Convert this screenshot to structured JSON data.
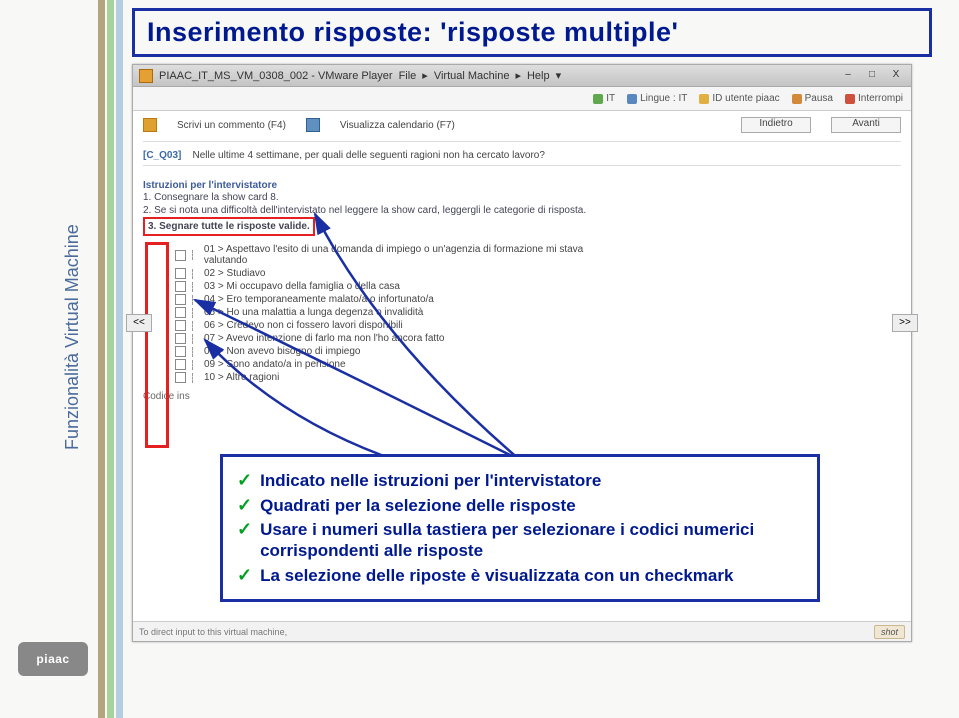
{
  "sidebar": {
    "label": "Funzionalità Virtual Machine"
  },
  "logo": {
    "text": "piaac"
  },
  "title": "Inserimento risposte: 'risposte multiple'",
  "vm": {
    "title": "PIAAC_IT_MS_VM_0308_002 - VMware Player",
    "menu": {
      "file": "File",
      "vm_menu": "Virtual Machine",
      "help": "Help"
    },
    "winbtns": {
      "min": "–",
      "max": "□",
      "close": "X"
    },
    "toolbar": {
      "it": "IT",
      "lingue": "Lingue : IT",
      "id": "ID utente piaac",
      "pausa": "Pausa",
      "interrompi": "Interrompi"
    },
    "row1": {
      "scrivi": "Scrivi un commento (F4)",
      "visualizza": "Visualizza calendario (F7)",
      "indietro": "Indietro",
      "avanti": "Avanti"
    },
    "nav": {
      "prev": "<<",
      "next": ">>"
    },
    "question": {
      "code": "[C_Q03]",
      "text": "Nelle ultime 4 settimane, per quali delle seguenti ragioni non ha cercato lavoro?"
    },
    "instructions": {
      "head": "Istruzioni per l'intervistatore",
      "l1": "1. Consegnare la show card 8.",
      "l2": "2. Se si nota una difficoltà dell'intervistato nel leggere la show card, leggergli le categorie di risposta.",
      "l3": "3. Segnare tutte le risposte valide."
    },
    "options": [
      "01 > Aspettavo l'esito di una domanda di impiego o un'agenzia di formazione mi stava valutando",
      "02 > Studiavo",
      "03 > Mi occupavo della famiglia o della casa",
      "04 > Ero temporaneamente malato/a o infortunato/a",
      "05 > Ho una malattia a lunga degenza o invalidità",
      "06 > Credevo non ci fossero lavori disponibili",
      "07 > Avevo intenzione di farlo ma non l'ho ancora fatto",
      "08 > Non avevo bisogno di impiego",
      "09 > Sono andato/a in pensione",
      "10 > Altre ragioni"
    ],
    "codice": "Codice ins",
    "footer": {
      "text": "To direct input to this virtual machine,",
      "badge": "shot"
    }
  },
  "annot": {
    "b1": "Indicato nelle istruzioni per l'intervistatore",
    "b2": "Quadrati per la selezione delle risposte",
    "b3": "Usare i numeri sulla tastiera per selezionare i codici numerici corrispondenti alle risposte",
    "b4": "La selezione delle riposte è visualizzata con un checkmark"
  }
}
